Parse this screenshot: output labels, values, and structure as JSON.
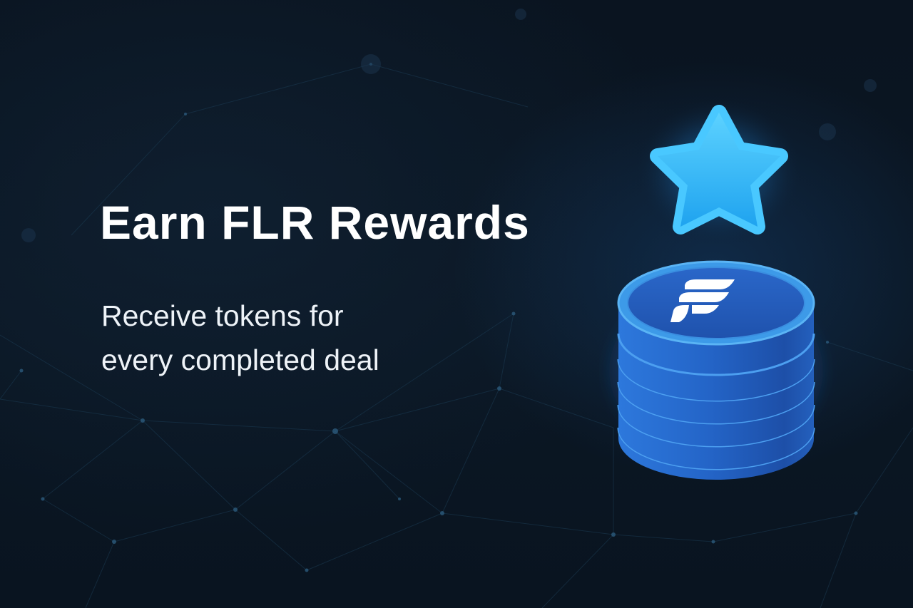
{
  "banner": {
    "headline": "Earn FLR Rewards",
    "subline_1": "Receive tokens for",
    "subline_2": "every completed deal"
  },
  "illustration": {
    "star_icon": "star-icon",
    "coin_stack_icon": "coin-stack-icon",
    "logo_icon": "flare-logo-icon"
  },
  "colors": {
    "background": "#0a1420",
    "text": "#ffffff",
    "star": "#2fb7f5",
    "coin": "#2a6fd6",
    "coin_rim": "#4aa8f0"
  }
}
